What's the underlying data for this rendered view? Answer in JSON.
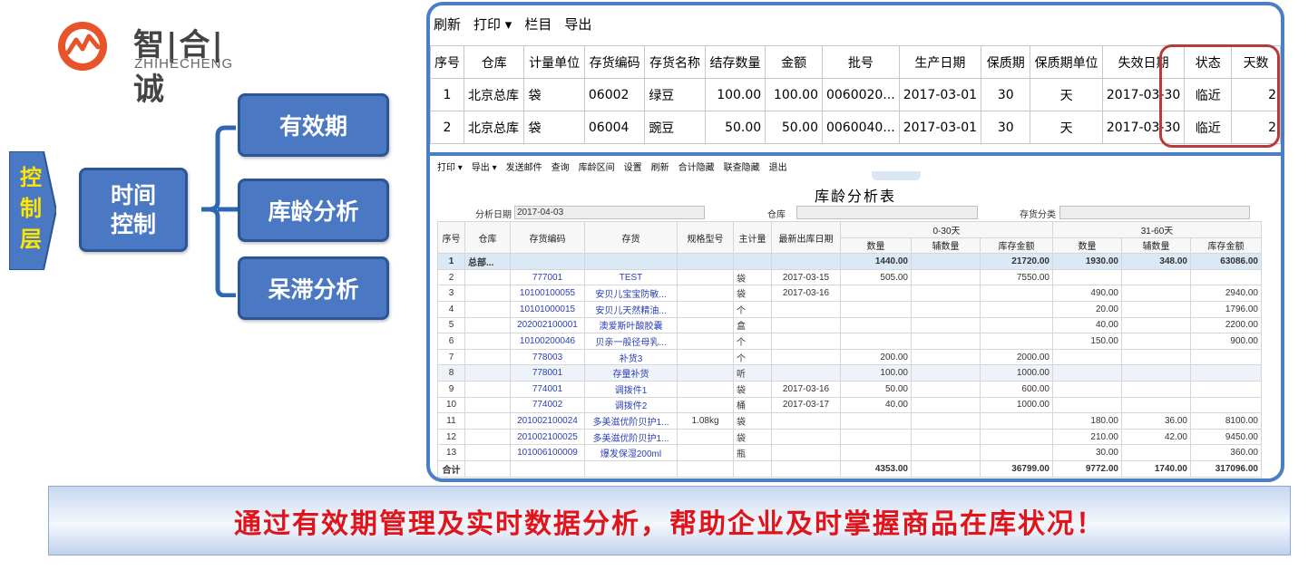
{
  "logo": {
    "brand_cn": "智|合|诚",
    "brand_en": "ZHIHECHENG"
  },
  "diagram": {
    "layer_tag": "控制层",
    "time_box": "时间控制",
    "branches": [
      "有效期",
      "库龄分析",
      "呆滞分析"
    ]
  },
  "grid1": {
    "toolbar": [
      "刷新",
      "打印 ▾",
      "栏目",
      "导出"
    ],
    "columns": [
      "序号",
      "仓库",
      "计量单位",
      "存货编码",
      "存货名称",
      "结存数量",
      "金额",
      "批号",
      "生产日期",
      "保质期",
      "保质期单位",
      "失效日期",
      "状态",
      "天数"
    ],
    "rows": [
      [
        "1",
        "北京总库",
        "袋",
        "06002",
        "绿豆",
        "100.00",
        "100.00",
        "0060020...",
        "2017-03-01",
        "30",
        "天",
        "2017-03-30",
        "临近",
        "2"
      ],
      [
        "2",
        "北京总库",
        "袋",
        "06004",
        "豌豆",
        "50.00",
        "50.00",
        "0060040...",
        "2017-03-01",
        "30",
        "天",
        "2017-03-30",
        "临近",
        "2"
      ]
    ]
  },
  "report": {
    "toolbar": [
      "打印 ▾",
      "导出 ▾",
      "发送邮件",
      "查询",
      "库龄区间",
      "设置",
      "刷新",
      "合计隐藏",
      "联查隐藏",
      "退出"
    ],
    "title": "库龄分析表",
    "filters": {
      "date_label": "分析日期",
      "date_value": "2017-04-03",
      "warehouse_label": "仓库",
      "category_label": "存货分类"
    },
    "group_headers": [
      "0-30天",
      "31-60天"
    ],
    "columns": [
      "序号",
      "仓库",
      "存货编码",
      "存货",
      "规格型号",
      "主计量",
      "最新出库日期"
    ],
    "sub_columns": [
      "数量",
      "辅数量",
      "库存金额",
      "数量",
      "辅数量",
      "库存金额"
    ],
    "rows": [
      [
        "1",
        "总部...",
        "",
        "",
        "",
        "",
        "",
        "1440.00",
        "",
        "21720.00",
        "1930.00",
        "348.00",
        "63086.00"
      ],
      [
        "2",
        "",
        "777001",
        "TEST",
        "",
        "袋",
        "2017-03-15",
        "505.00",
        "",
        "7550.00",
        "",
        "",
        ""
      ],
      [
        "3",
        "",
        "10100100055",
        "安贝儿宝宝防敏...",
        "",
        "袋",
        "2017-03-16",
        "",
        "",
        "",
        "490.00",
        "",
        "2940.00"
      ],
      [
        "4",
        "",
        "10101000015",
        "安贝儿天然精油...",
        "",
        "个",
        "",
        "",
        "",
        "",
        "20.00",
        "",
        "1796.00"
      ],
      [
        "5",
        "",
        "202002100001",
        "澳爱斯叶酸胶囊",
        "",
        "盒",
        "",
        "",
        "",
        "",
        "40.00",
        "",
        "2200.00"
      ],
      [
        "6",
        "",
        "10100200046",
        "贝亲一般径母乳...",
        "",
        "个",
        "",
        "",
        "",
        "",
        "150.00",
        "",
        "900.00"
      ],
      [
        "7",
        "",
        "778003",
        "补货3",
        "",
        "个",
        "",
        "200.00",
        "",
        "2000.00",
        "",
        "",
        ""
      ],
      [
        "8",
        "",
        "778001",
        "存量补货",
        "",
        "听",
        "",
        "100.00",
        "",
        "1000.00",
        "",
        "",
        ""
      ],
      [
        "9",
        "",
        "774001",
        "调拨件1",
        "",
        "袋",
        "2017-03-16",
        "50.00",
        "",
        "600.00",
        "",
        "",
        ""
      ],
      [
        "10",
        "",
        "774002",
        "调拨件2",
        "",
        "桶",
        "2017-03-17",
        "40.00",
        "",
        "1000.00",
        "",
        "",
        ""
      ],
      [
        "11",
        "",
        "201002100024",
        "多美滋优阶贝护1...",
        "1.08kg",
        "袋",
        "",
        "",
        "",
        "",
        "180.00",
        "36.00",
        "8100.00"
      ],
      [
        "12",
        "",
        "201002100025",
        "多美滋优阶贝护1...",
        "",
        "袋",
        "",
        "",
        "",
        "",
        "210.00",
        "42.00",
        "9450.00"
      ],
      [
        "13",
        "",
        "101006100009",
        "爆发保湿200ml",
        "",
        "瓶",
        "",
        "",
        "",
        "",
        "30.00",
        "",
        "360.00"
      ]
    ],
    "total": [
      "合计",
      "",
      "",
      "",
      "",
      "",
      "",
      "4353.00",
      "",
      "36799.00",
      "9772.00",
      "1740.00",
      "317096.00"
    ]
  },
  "banner": "通过有效期管理及实时数据分析，帮助企业及时掌握商品在库状况！"
}
